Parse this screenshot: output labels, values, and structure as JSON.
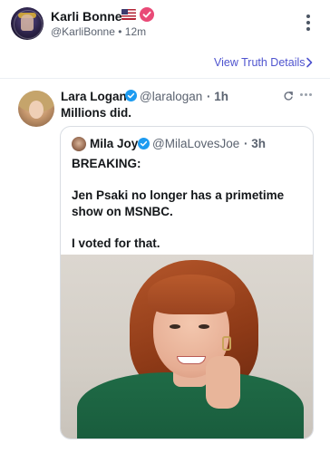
{
  "post": {
    "author_name": "Karli Bonne'",
    "author_handle": "@KarliBonne",
    "separator": "•",
    "time": "12m",
    "flag_emoji_label": "us-flag",
    "badge_color": "#e94a77",
    "truth_details_label": "View Truth Details",
    "accent_color": "#4f54cf"
  },
  "embed": {
    "author_name": "Lara Logan",
    "author_handle": "@laralogan",
    "time": "· 1h",
    "text": "Millions did.",
    "verified_color": "#1d9bf0"
  },
  "quote": {
    "author_name": "Mila Joy",
    "author_handle": "@MilaLovesJoe",
    "time": "· 3h",
    "line1": "BREAKING:",
    "line2": "Jen Psaki no longer has a primetime",
    "line3": "show on MSNBC.",
    "line4": "I voted for that."
  }
}
